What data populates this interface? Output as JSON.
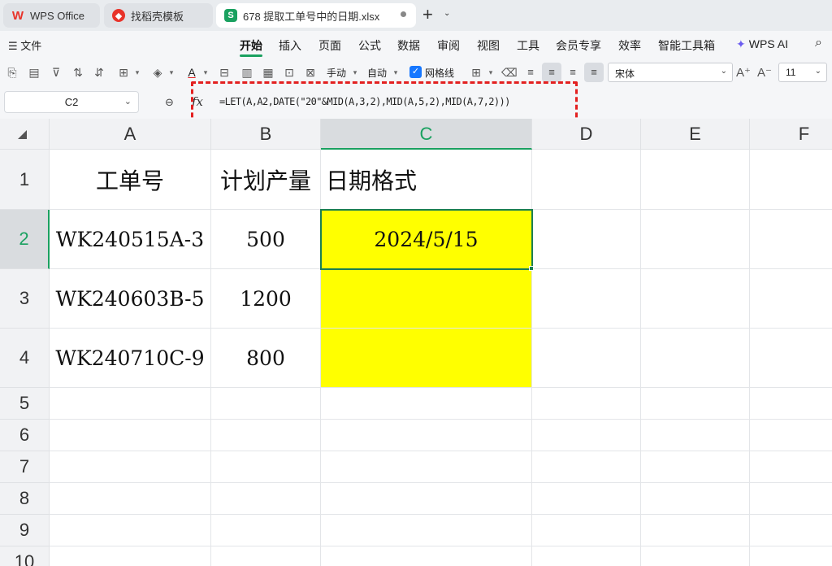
{
  "tabs": {
    "wps": "WPS Office",
    "templates": "找稻壳模板",
    "file": "678 提取工单号中的日期.xlsx",
    "plus": "+",
    "down": "⌄",
    "app_icon_letter": "S"
  },
  "menu": {
    "file": "☰ 文件",
    "items": [
      "开始",
      "插入",
      "页面",
      "公式",
      "数据",
      "审阅",
      "视图",
      "工具",
      "会员专享",
      "效率",
      "智能工具箱"
    ],
    "ai": "WPS AI"
  },
  "toolbar": {
    "manual": "手动",
    "auto": "自动",
    "gridlines": "网格线",
    "font_name": "宋体",
    "font_size": "11"
  },
  "formula_bar": {
    "name_box": "C2",
    "fx": "fx",
    "formula": "=LET(A,A2,DATE(\"20\"&MID(A,3,2),MID(A,5,2),MID(A,7,2)))"
  },
  "sheet": {
    "columns": [
      "A",
      "B",
      "C",
      "D",
      "E",
      "F"
    ],
    "rows": [
      "1",
      "2",
      "3",
      "4",
      "5",
      "6",
      "7",
      "8",
      "9",
      "10"
    ],
    "selected_cell": "C2",
    "cells": {
      "A1": "工单号",
      "B1": "计划产量",
      "C1": "日期格式",
      "A2": "WK240515A-3",
      "B2": "500",
      "C2": "2024/5/15",
      "A3": "WK240603B-5",
      "B3": "1200",
      "A4": "WK240710C-9",
      "B4": "800"
    },
    "highlight_color": "#ffff00",
    "accent_color": "#1aa160"
  }
}
